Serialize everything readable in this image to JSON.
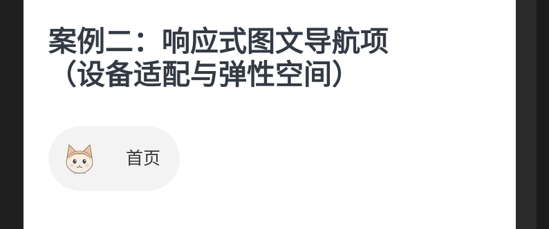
{
  "heading": {
    "line1": "案例二：响应式图文导航项",
    "line2": "（设备适配与弹性空间）"
  },
  "nav_item": {
    "icon": "cat-icon",
    "label": "首页"
  },
  "colors": {
    "page_background": "#ffffff",
    "frame_background": "#1f1f1f",
    "title_text": "#333a44",
    "nav_item_background": "#f3f3f3",
    "nav_label_text": "#333333"
  }
}
